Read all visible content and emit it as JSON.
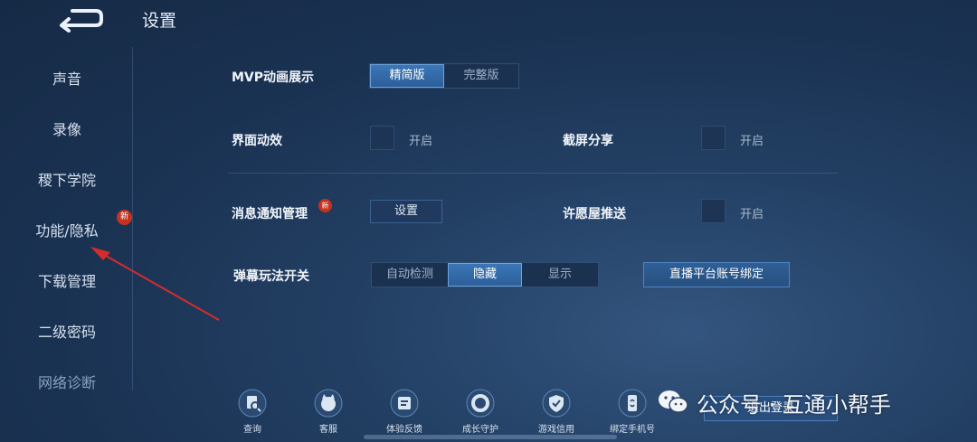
{
  "header": {
    "title": "设置",
    "back_icon": "back-arrow-icon"
  },
  "sidebar": {
    "items": [
      {
        "label": "声音"
      },
      {
        "label": "录像"
      },
      {
        "label": "稷下学院"
      },
      {
        "label": "功能/隐私",
        "badge": "新"
      },
      {
        "label": "下载管理"
      },
      {
        "label": "二级密码"
      },
      {
        "label": "网络诊断"
      }
    ]
  },
  "settings": {
    "mvp": {
      "label": "MVP动画展示",
      "options": [
        "精简版",
        "完整版"
      ],
      "selected": "精简版"
    },
    "ui_effects": {
      "label": "界面动效",
      "option": "开启",
      "checked": false
    },
    "screenshot_share": {
      "label": "截屏分享",
      "option": "开启",
      "checked": false
    },
    "notification": {
      "label": "消息通知管理",
      "badge": "新",
      "button": "设置"
    },
    "wish_push": {
      "label": "许愿屋推送",
      "option": "开启",
      "checked": false
    },
    "barrage": {
      "label": "弹幕玩法开关",
      "options": [
        "自动检测",
        "隐藏",
        "显示"
      ],
      "selected": "隐藏"
    },
    "stream_bind_button": "直播平台账号绑定"
  },
  "bottom_bar": {
    "items": [
      {
        "label": "查询",
        "icon": "search-doc-icon"
      },
      {
        "label": "客服",
        "icon": "support-icon"
      },
      {
        "label": "体验反馈",
        "icon": "feedback-icon"
      },
      {
        "label": "成长守护",
        "icon": "guard-ring-icon"
      },
      {
        "label": "游戏信用",
        "icon": "shield-icon"
      },
      {
        "label": "绑定手机号",
        "icon": "phone-link-icon"
      }
    ],
    "logout": "退出登录"
  },
  "watermark": {
    "text": "公众号 · 互通小帮手"
  },
  "colors": {
    "accent": "#3b77b8",
    "badge": "#c7321e",
    "annotation_arrow": "#d62c2c"
  }
}
